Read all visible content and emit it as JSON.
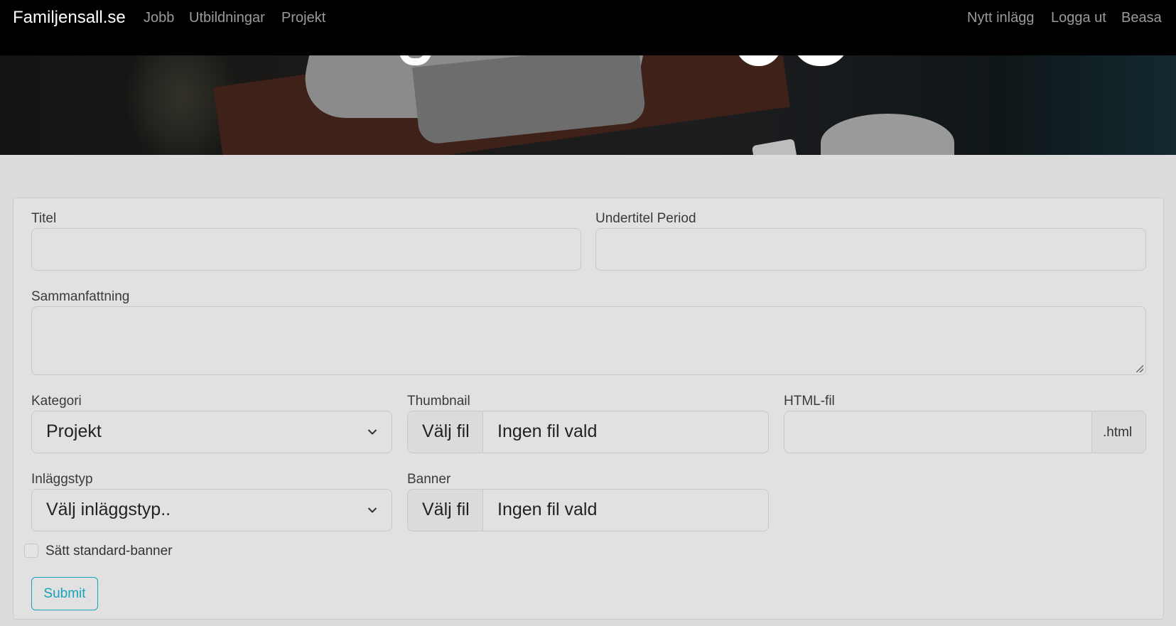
{
  "navbar": {
    "brand": "Familjensall.se",
    "left_links": [
      "Jobb",
      "Utbildningar",
      "Projekt"
    ],
    "right_links": [
      "Nytt inlägg",
      "Logga ut",
      "Beasa"
    ]
  },
  "form": {
    "titel_label": "Titel",
    "titel_value": "",
    "undertitel_label": "Undertitel Period",
    "undertitel_value": "",
    "sammanfattning_label": "Sammanfattning",
    "sammanfattning_value": "",
    "kategori_label": "Kategori",
    "kategori_value": "Projekt",
    "thumbnail_label": "Thumbnail",
    "thumbnail_button": "Välj fil",
    "thumbnail_status": "Ingen fil vald",
    "html_label": "HTML-fil",
    "html_value": "",
    "html_addon": ".html",
    "inlaggstyp_label": "Inläggstyp",
    "inlaggstyp_value": "Välj inläggstyp..",
    "banner_label": "Banner",
    "banner_button": "Välj fil",
    "banner_status": "Ingen fil vald",
    "standard_banner_label": "Sätt standard-banner",
    "standard_banner_checked": false,
    "submit_label": "Submit"
  },
  "colors": {
    "navbar_bg": "#000000",
    "page_bg": "#dcdcdc",
    "accent": "#17a2b8"
  }
}
